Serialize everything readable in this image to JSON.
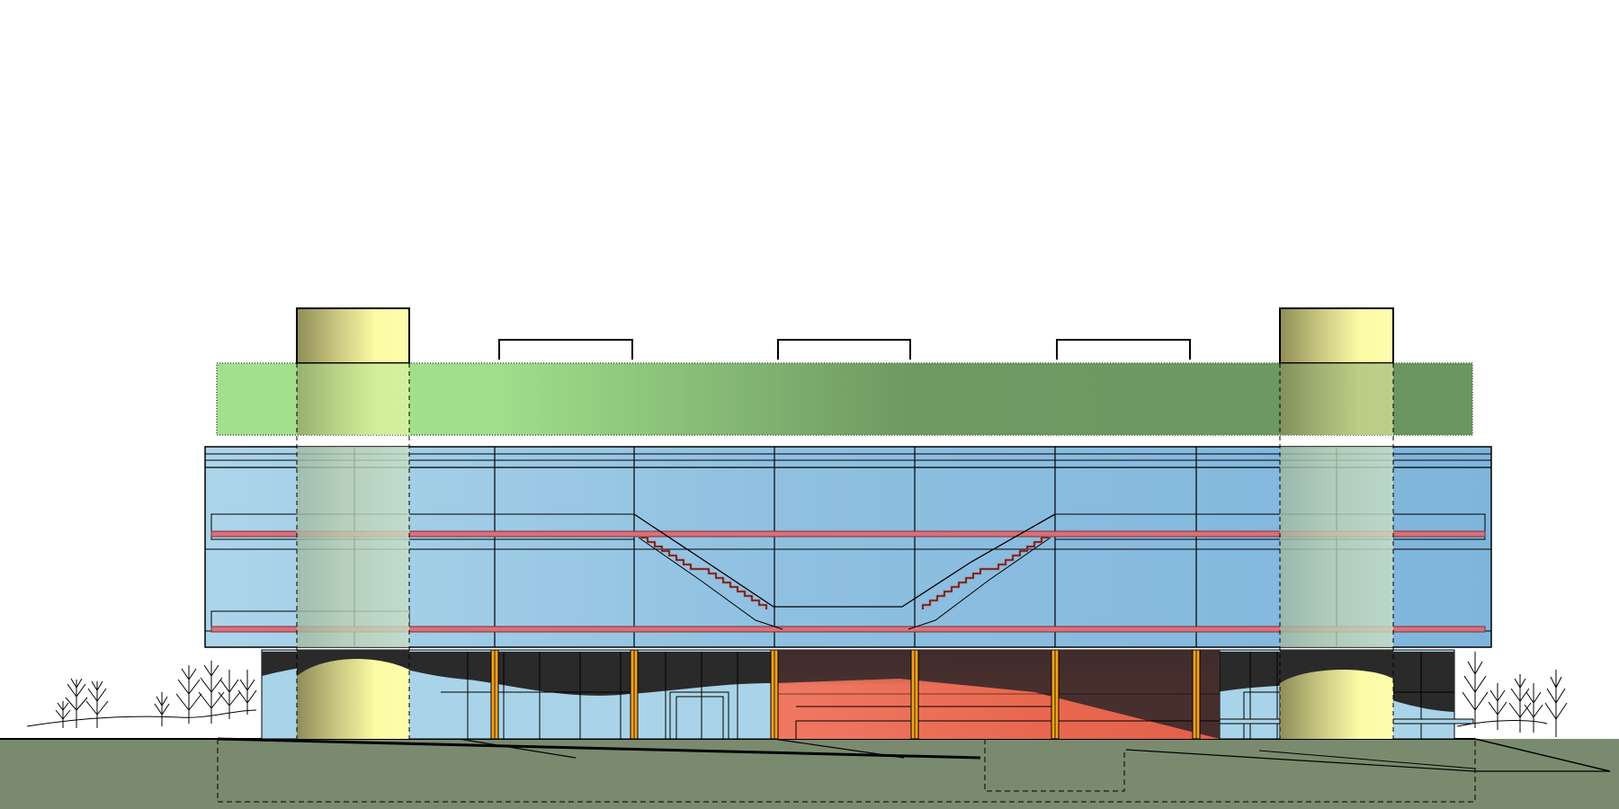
{
  "drawing": {
    "kind": "architectural-elevation",
    "colors": {
      "background": "#ffffff",
      "ground": "#7a8a6e",
      "green_roof_light": "#a3e08e",
      "green_roof_dark": "#6c9660",
      "glass_light": "#a9d3e8",
      "glass_dark": "#80b6dd",
      "tower_yellow": "#fcfca6",
      "tower_olive": "#a3a068",
      "accent_red": "#e8604e",
      "red_rail": "#d9707a",
      "column_orange": "#f3a020",
      "dark_interior": "#2a2a2a",
      "line": "#000000"
    },
    "components": [
      "green-roof-band",
      "upper-glass-volume",
      "left-tower",
      "right-tower",
      "ground-floor-glazing",
      "red-lobby-volume",
      "orange-columns",
      "ramp-stairs",
      "rooftop-frames",
      "trees",
      "ground-section"
    ]
  }
}
